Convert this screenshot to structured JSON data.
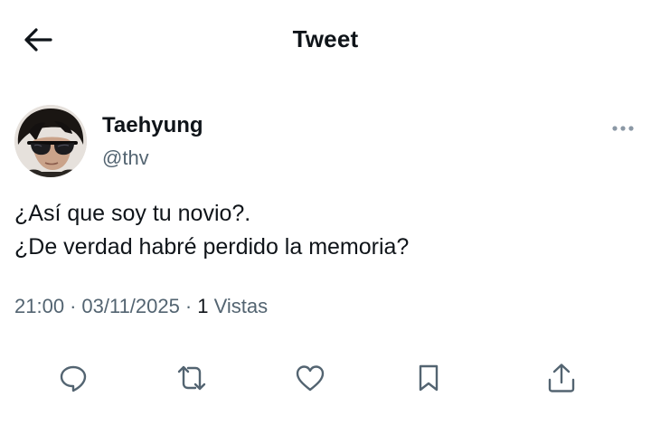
{
  "header": {
    "title": "Tweet",
    "back_icon": "arrow-left-icon"
  },
  "tweet": {
    "author": {
      "name": "Taehyung",
      "handle": "@thv"
    },
    "text_lines": [
      "¿Así que soy tu novio?.",
      "¿De verdad habré perdido la memoria?"
    ],
    "meta": {
      "time": "21:00",
      "date": "03/11/2025",
      "separator": "·",
      "views_count": "1",
      "views_label": "Vistas"
    }
  },
  "actions": [
    {
      "name": "reply-button",
      "icon": "speech-bubble-icon"
    },
    {
      "name": "retweet-button",
      "icon": "retweet-icon"
    },
    {
      "name": "like-button",
      "icon": "heart-icon"
    },
    {
      "name": "bookmark-button",
      "icon": "bookmark-icon"
    },
    {
      "name": "share-button",
      "icon": "share-icon"
    }
  ],
  "colors": {
    "text_primary": "#0f1419",
    "text_secondary": "#536471",
    "icon": "#536471",
    "background": "#ffffff"
  }
}
